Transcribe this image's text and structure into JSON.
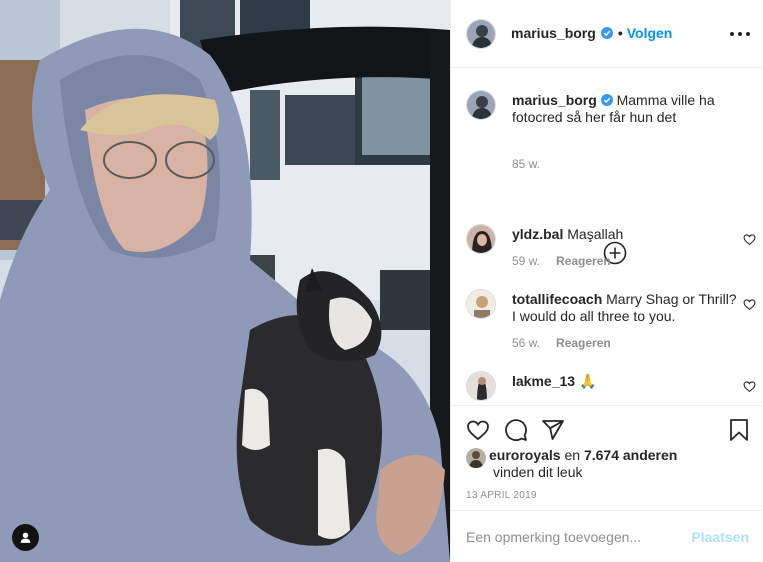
{
  "post": {
    "author": "marius_borg",
    "follow_label": "Volgen",
    "separator": "•",
    "caption": "Mamma ville ha fotocred så her får hun det",
    "caption_age": "85 w.",
    "photo_icon": "user-tag-icon"
  },
  "comments": [
    {
      "user": "yldz.bal",
      "text": "Maşallah",
      "age": "59 w.",
      "reply_label": "Reageren"
    },
    {
      "user": "totallifecoach",
      "text": "Marry Shag or Thrill? I would do all three to you.",
      "age": "56 w.",
      "reply_label": "Reageren"
    },
    {
      "user": "lakme_13",
      "text": "🙏"
    }
  ],
  "likes": {
    "liker": "euroroyals",
    "connector": "en",
    "others": "7.674 anderen",
    "suffix": "vinden dit leuk"
  },
  "date": "13 APRIL 2019",
  "add_comment": {
    "placeholder": "Een opmerking toevoegen...",
    "post_label": "Plaatsen"
  },
  "colors": {
    "accent": "#0095f6",
    "verified": "#3897f0",
    "post_disabled": "#b2dffc",
    "muted": "#8e8e8e"
  },
  "icons": [
    "more-options-icon",
    "verified-badge-icon",
    "add-circle-icon",
    "heart-icon",
    "comment-icon",
    "share-icon",
    "bookmark-icon"
  ]
}
